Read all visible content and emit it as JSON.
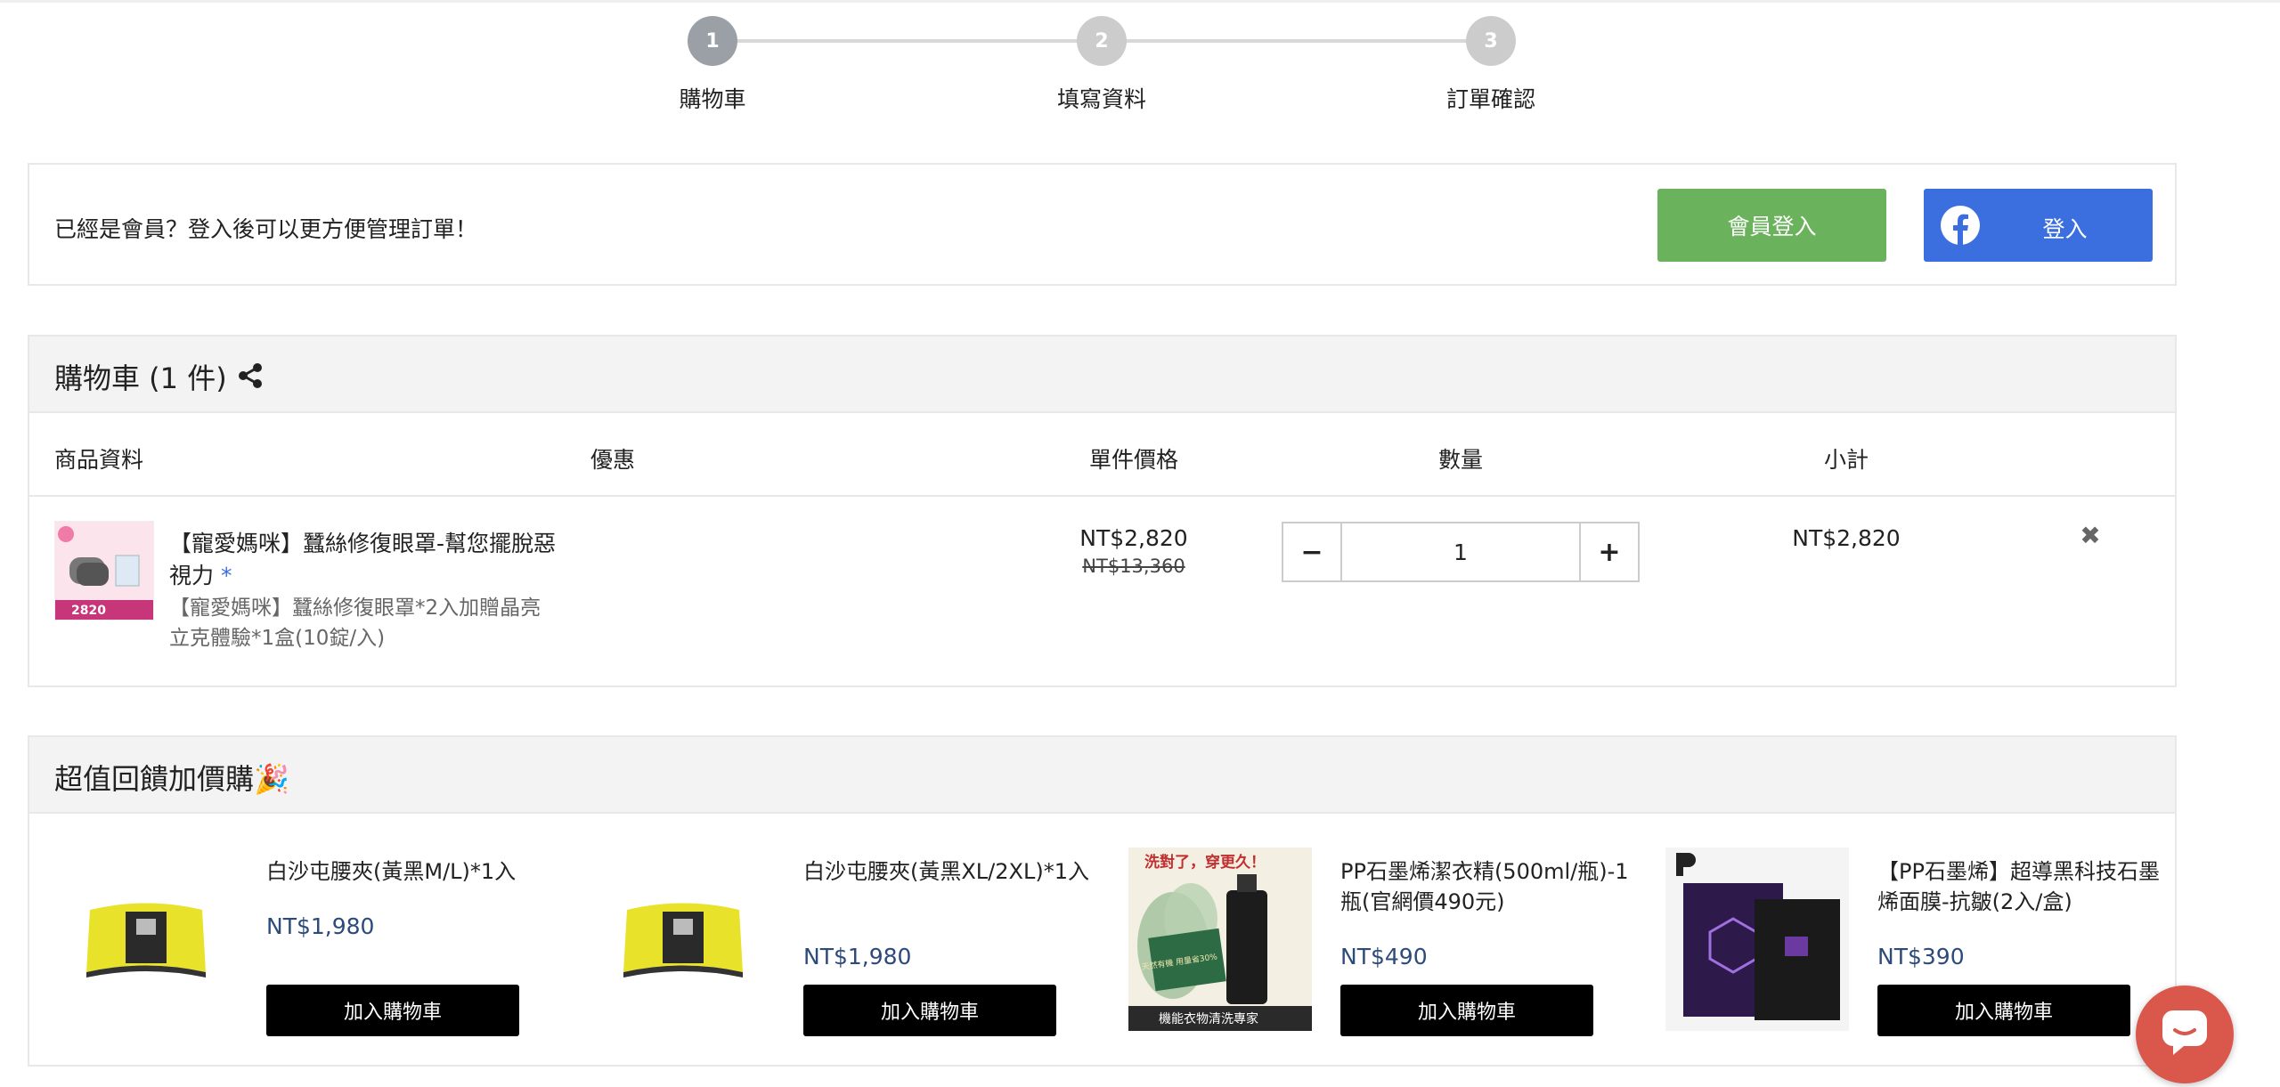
{
  "stepper": {
    "steps": [
      {
        "number": "1",
        "label": "購物車"
      },
      {
        "number": "2",
        "label": "填寫資料"
      },
      {
        "number": "3",
        "label": "訂單確認"
      }
    ]
  },
  "member": {
    "message": "已經是會員？登入後可以更方便管理訂單！",
    "member_login_label": "會員登入",
    "fb_login_label": "登入"
  },
  "cart": {
    "title": "購物車 (1 件)",
    "columns": {
      "product": "商品資料",
      "promotion": "優惠",
      "unit_price": "單件價格",
      "quantity": "數量",
      "subtotal": "小計"
    },
    "item": {
      "name": "【寵愛媽咪】蠶絲修復眼罩-幫您擺脫惡視力",
      "required_mark": "*",
      "variant": "【寵愛媽咪】蠶絲修復眼罩*2入加贈晶亮立克體驗*1盒(10錠/入)",
      "thumb_price": "2820",
      "unit_price": "NT$2,820",
      "original_price": "NT$13,360",
      "quantity": "1",
      "subtotal": "NT$2,820"
    }
  },
  "addon": {
    "title": "超值回饋加價購🎉",
    "button_label": "加入購物車",
    "items": [
      {
        "name": "白沙屯腰夾(黃黑M/L)*1入",
        "price": "NT$1,980"
      },
      {
        "name": "白沙屯腰夾(黃黑XL/2XL)*1入",
        "price": "NT$1,980"
      },
      {
        "name": "PP石墨烯潔衣精(500ml/瓶)-1瓶(官網價490元)",
        "price": "NT$490",
        "image_text_top": "洗對了，穿更久！",
        "image_text_badge": "天然有機 用量省30%",
        "image_text_bottom": "機能衣物清洗專家"
      },
      {
        "name": "【PP石墨烯】超導黑科技石墨烯面膜-抗皺(2入/盒)",
        "price": "NT$390"
      }
    ]
  },
  "colors": {
    "member_button": "#6ab25c",
    "facebook_button": "#3b6fe0",
    "price_text": "#2c4a7a",
    "chat_button": "#d9574b"
  }
}
